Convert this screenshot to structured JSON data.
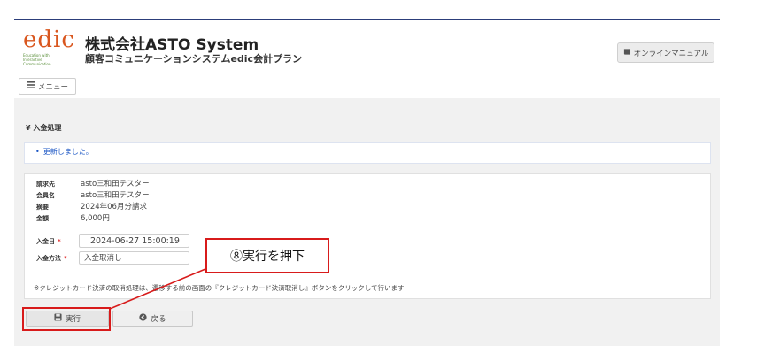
{
  "header": {
    "logo_word": "edic",
    "logo_tagline_1": "Education with",
    "logo_tagline_2": "Interactive",
    "logo_tagline_3": "Communication",
    "company": "株式会社ASTO System",
    "system_name": "顧客コミュニケーションシステムedic会計プラン",
    "manual_label": "オンラインマニュアル",
    "menu_label": "メニュー"
  },
  "page": {
    "title": "¥ 入金処理",
    "alert": "更新しました。"
  },
  "details": [
    {
      "label": "請求先",
      "value": "asto三和田テスター"
    },
    {
      "label": "会員名",
      "value": "asto三和田テスター"
    },
    {
      "label": "摘要",
      "value": "2024年06月分請求"
    },
    {
      "label": "金額",
      "value": "6,000円"
    }
  ],
  "form": {
    "date_label": "入金日",
    "date_value": "2024-06-27 15:00:19",
    "method_label": "入金方法",
    "method_value": "入金取消し",
    "required_mark": "*",
    "note": "※クレジットカード決済の取消処理は、遷移する前の画面の『クレジットカード決済取消し』ボタンをクリックして行います"
  },
  "buttons": {
    "execute": "実行",
    "back": "戻る"
  },
  "annotation": {
    "callout_text": "⑧実行を押下"
  },
  "colors": {
    "accent_red": "#d81b1b",
    "header_line": "#2c3e7a",
    "logo_orange": "#d9571f",
    "alert_blue": "#1a55c4"
  }
}
